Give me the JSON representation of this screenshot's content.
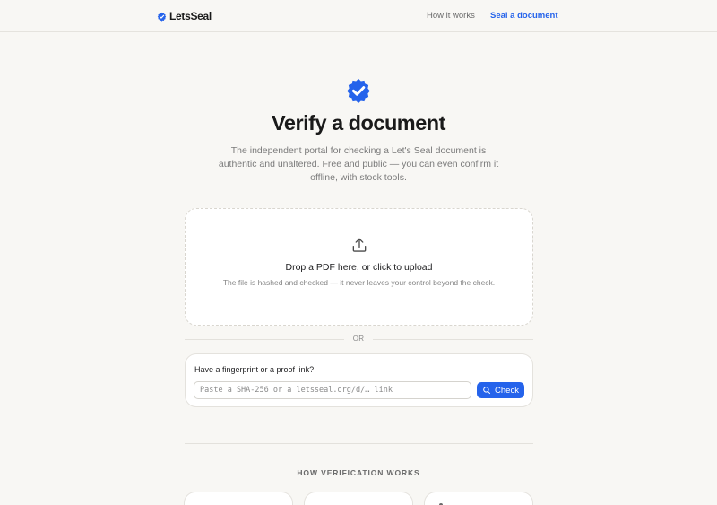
{
  "brand": {
    "name": "LetsSeal",
    "icon": "verified-badge-icon",
    "accent": "#2563eb"
  },
  "nav": {
    "how_it_works": "How it works",
    "seal_document": "Seal a document"
  },
  "hero": {
    "icon": "verified-badge-icon",
    "title": "Verify a document",
    "subtitle": "The independent portal for checking a Let's Seal document is authentic and unaltered. Free and public — you can even confirm it offline, with stock tools."
  },
  "dropzone": {
    "icon": "upload-icon",
    "title": "Drop a PDF here, or click to upload",
    "note": "The file is hashed and checked — it never leaves your control beyond the check."
  },
  "divider": {
    "or": "OR"
  },
  "fingerprint": {
    "label": "Have a fingerprint or a proof link?",
    "value": "",
    "placeholder": "Paste a SHA-256 or a letsseal.org/d/… link",
    "button_label": "Check",
    "button_icon": "search-icon"
  },
  "how": {
    "title": "HOW VERIFICATION WORKS"
  },
  "colors": {
    "background": "#f8f7f4",
    "primary": "#2563eb",
    "card": "#ffffff",
    "border": "#e4e2dd"
  }
}
